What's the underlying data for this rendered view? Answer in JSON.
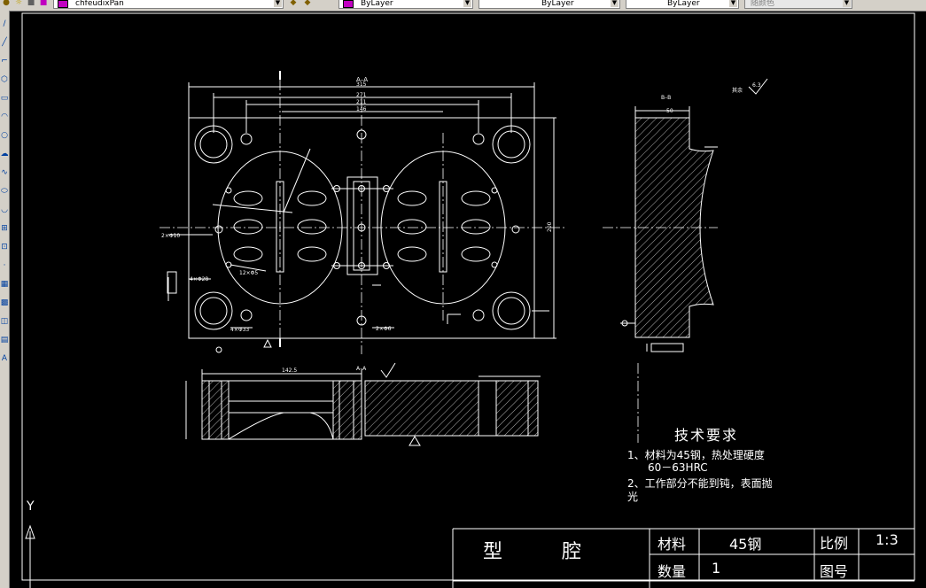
{
  "toolbar": {
    "layer_name": "chfeudixPan",
    "color": "ByLayer",
    "linetype": "ByLayer",
    "lineweight": "ByLayer",
    "plot_style": "随颜色",
    "layer_swatch": "#c000c0",
    "color_swatch": "#c000c0"
  },
  "left_tools": [
    "line-icon",
    "xline-icon",
    "polyline-icon",
    "polygon-icon",
    "rectangle-icon",
    "arc-icon",
    "circle-icon",
    "revcloud-icon",
    "spline-icon",
    "ellipse-icon",
    "ellipse-arc-icon",
    "insert-block-icon",
    "make-block-icon",
    "point-icon",
    "hatch-icon",
    "gradient-icon",
    "region-icon",
    "table-icon",
    "mtext-icon"
  ],
  "technical_requirements": {
    "title": "技术要求",
    "item1_line1": "1、材料为45钢，热处理硬度",
    "item1_line2": "60－63HRC",
    "item2_line1": "2、工作部分不能到钝，表面抛",
    "item2_line2": "光"
  },
  "title_block": {
    "part_name": "型 腔",
    "material_label": "材料",
    "material_value": "45钢",
    "scale_label": "比例",
    "scale_value": "1:3",
    "quantity_label": "数量",
    "quantity_value": "1",
    "drawing_no_label": "图号"
  },
  "annotations": {
    "section_top": "A–A",
    "section_bottom": "A–A",
    "section_side": "B–B",
    "rough_other": "其余",
    "rough_value": "6.3",
    "dim_315": "315",
    "dim_271": "271",
    "dim_211": "211",
    "dim_146": "146",
    "dim_200": "200",
    "dim_50": "50",
    "dim_142_5": "142.5",
    "hole_4x28": "4×Φ28",
    "hole_4x33": "4×Φ33",
    "hole_2x10": "2×Φ10",
    "hole_2x6": "2×Φ6",
    "hole_12x5": "12×Φ5"
  },
  "ucs": {
    "y_label": "Y"
  },
  "colors": {
    "background": "#000000",
    "lines": "#ffffff",
    "toolbar": "#d4d0c8",
    "accent_magenta": "#c000c0"
  }
}
